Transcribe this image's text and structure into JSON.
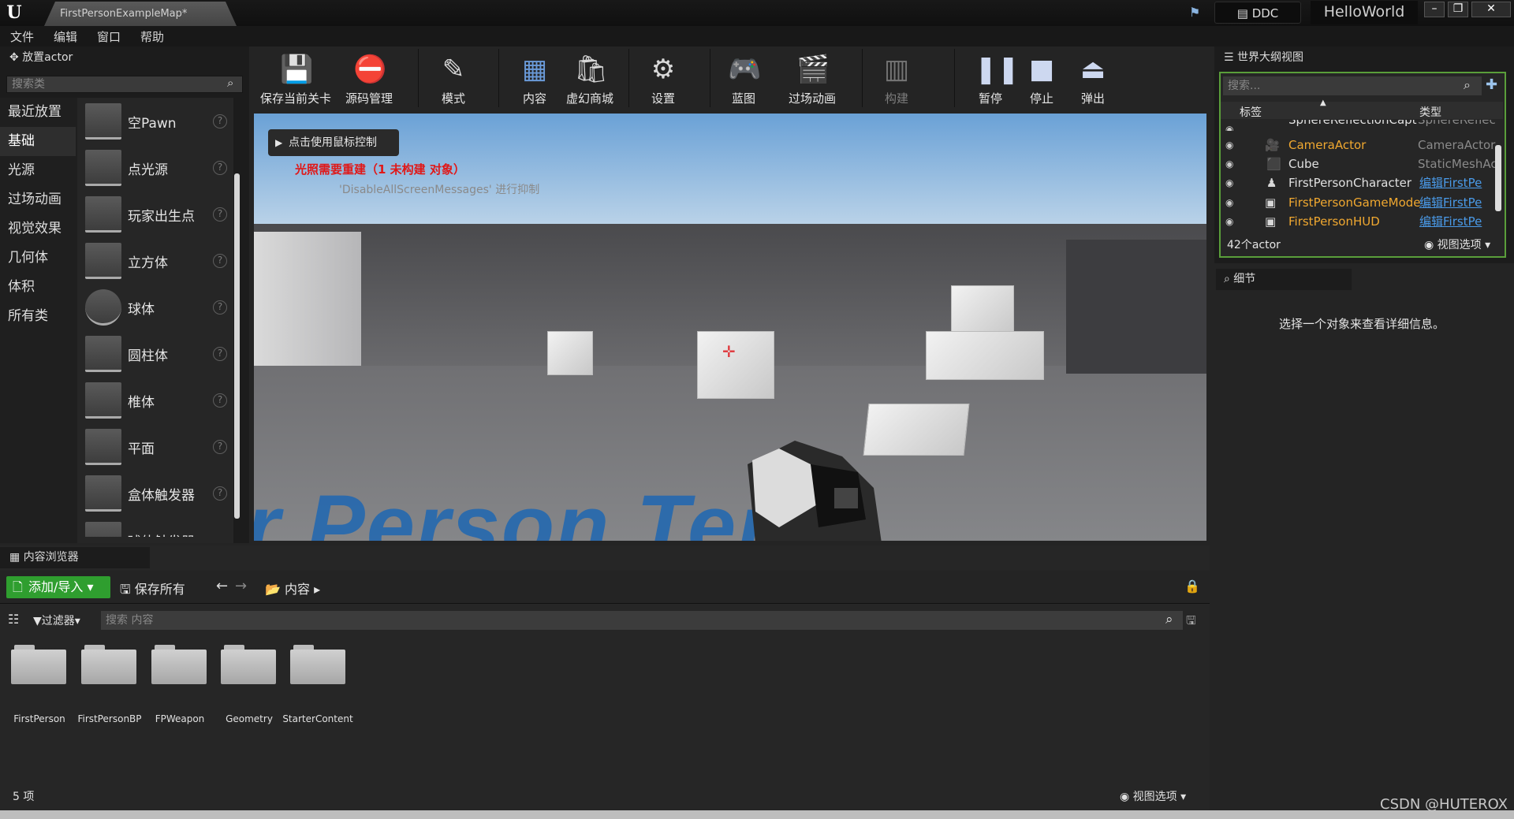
{
  "window": {
    "doc_tab": "FirstPersonExampleMap*",
    "ddc": "DDC",
    "project_name": "HelloWorld"
  },
  "menu": [
    "文件",
    "编辑",
    "窗口",
    "帮助"
  ],
  "place_actors": {
    "tab": "放置actor",
    "search_placeholder": "搜索类",
    "categories": [
      "最近放置",
      "基础",
      "光源",
      "过场动画",
      "视觉效果",
      "几何体",
      "体积",
      "所有类"
    ],
    "active_category": "基础",
    "items": [
      "空Pawn",
      "点光源",
      "玩家出生点",
      "立方体",
      "球体",
      "圆柱体",
      "椎体",
      "平面",
      "盒体触发器",
      "球体触发器"
    ]
  },
  "toolbar": {
    "buttons": [
      "保存当前关卡",
      "源码管理",
      "模式",
      "内容",
      "虚幻商城",
      "设置",
      "蓝图",
      "过场动画",
      "构建",
      "暂停",
      "停止",
      "弹出"
    ]
  },
  "viewport": {
    "mouse_hint": "点击使用鼠标控制",
    "lighting_warning": "光照需要重建（1 未构建 对象）",
    "suppress_note": "'DisableAllScreenMessages' 进行抑制",
    "floor_text": "r Person Tem"
  },
  "outliner": {
    "tab": "世界大纲视图",
    "search_placeholder": "搜索...",
    "col_label": "标签",
    "col_type": "类型",
    "rows": [
      {
        "name": "SphereReflectionCapt",
        "type": "SphereReflec"
      },
      {
        "name": "CameraActor",
        "type": "CameraActor"
      },
      {
        "name": "Cube",
        "type": "StaticMeshAc"
      },
      {
        "name": "FirstPersonCharacter",
        "link": "编辑FirstPe"
      },
      {
        "name": "FirstPersonGameMode",
        "link": "编辑FirstPe"
      },
      {
        "name": "FirstPersonHUD",
        "link": "编辑FirstPe"
      }
    ],
    "count": "42个actor",
    "view_options": "视图选项"
  },
  "details": {
    "tab": "细节",
    "message": "选择一个对象来查看详细信息。"
  },
  "content_browser": {
    "tab": "内容浏览器",
    "add_import": "添加/导入",
    "save_all": "保存所有",
    "path": "内容",
    "filters": "过滤器",
    "search_placeholder": "搜索 内容",
    "folders": [
      "FirstPerson",
      "FirstPersonBP",
      "FPWeapon",
      "Geometry",
      "StarterContent"
    ],
    "item_count": "5 项",
    "view_options": "视图选项"
  },
  "watermark": "CSDN @HUTEROX"
}
